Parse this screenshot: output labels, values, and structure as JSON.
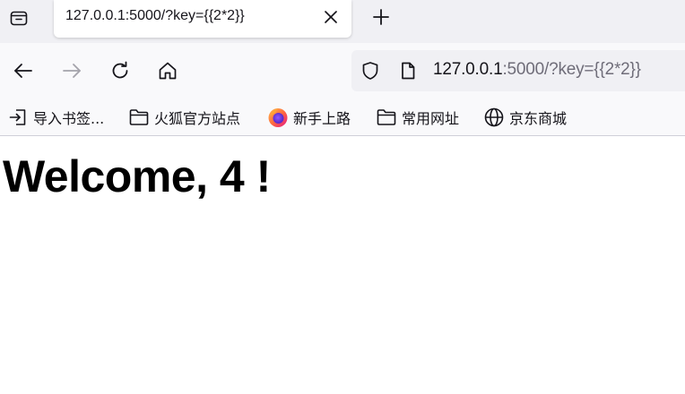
{
  "tab": {
    "title": "127.0.0.1:5000/?key={{2*2}}"
  },
  "urlbar": {
    "host": "127.0.0.1",
    "rest": ":5000/?key={{2*2}}"
  },
  "bookmarks": {
    "items": [
      {
        "label": "导入书签...",
        "icon": "import-icon"
      },
      {
        "label": "火狐官方站点",
        "icon": "folder-icon"
      },
      {
        "label": "新手上路",
        "icon": "firefox-logo-icon"
      },
      {
        "label": "常用网址",
        "icon": "folder-icon"
      },
      {
        "label": "京东商城",
        "icon": "globe-icon"
      }
    ]
  },
  "page": {
    "heading": "Welcome, 4 !"
  },
  "colors": {
    "tabstrip": "#f0f0f4",
    "toolbar": "#f9f9fb",
    "url_secondary": "#6f6d79"
  }
}
